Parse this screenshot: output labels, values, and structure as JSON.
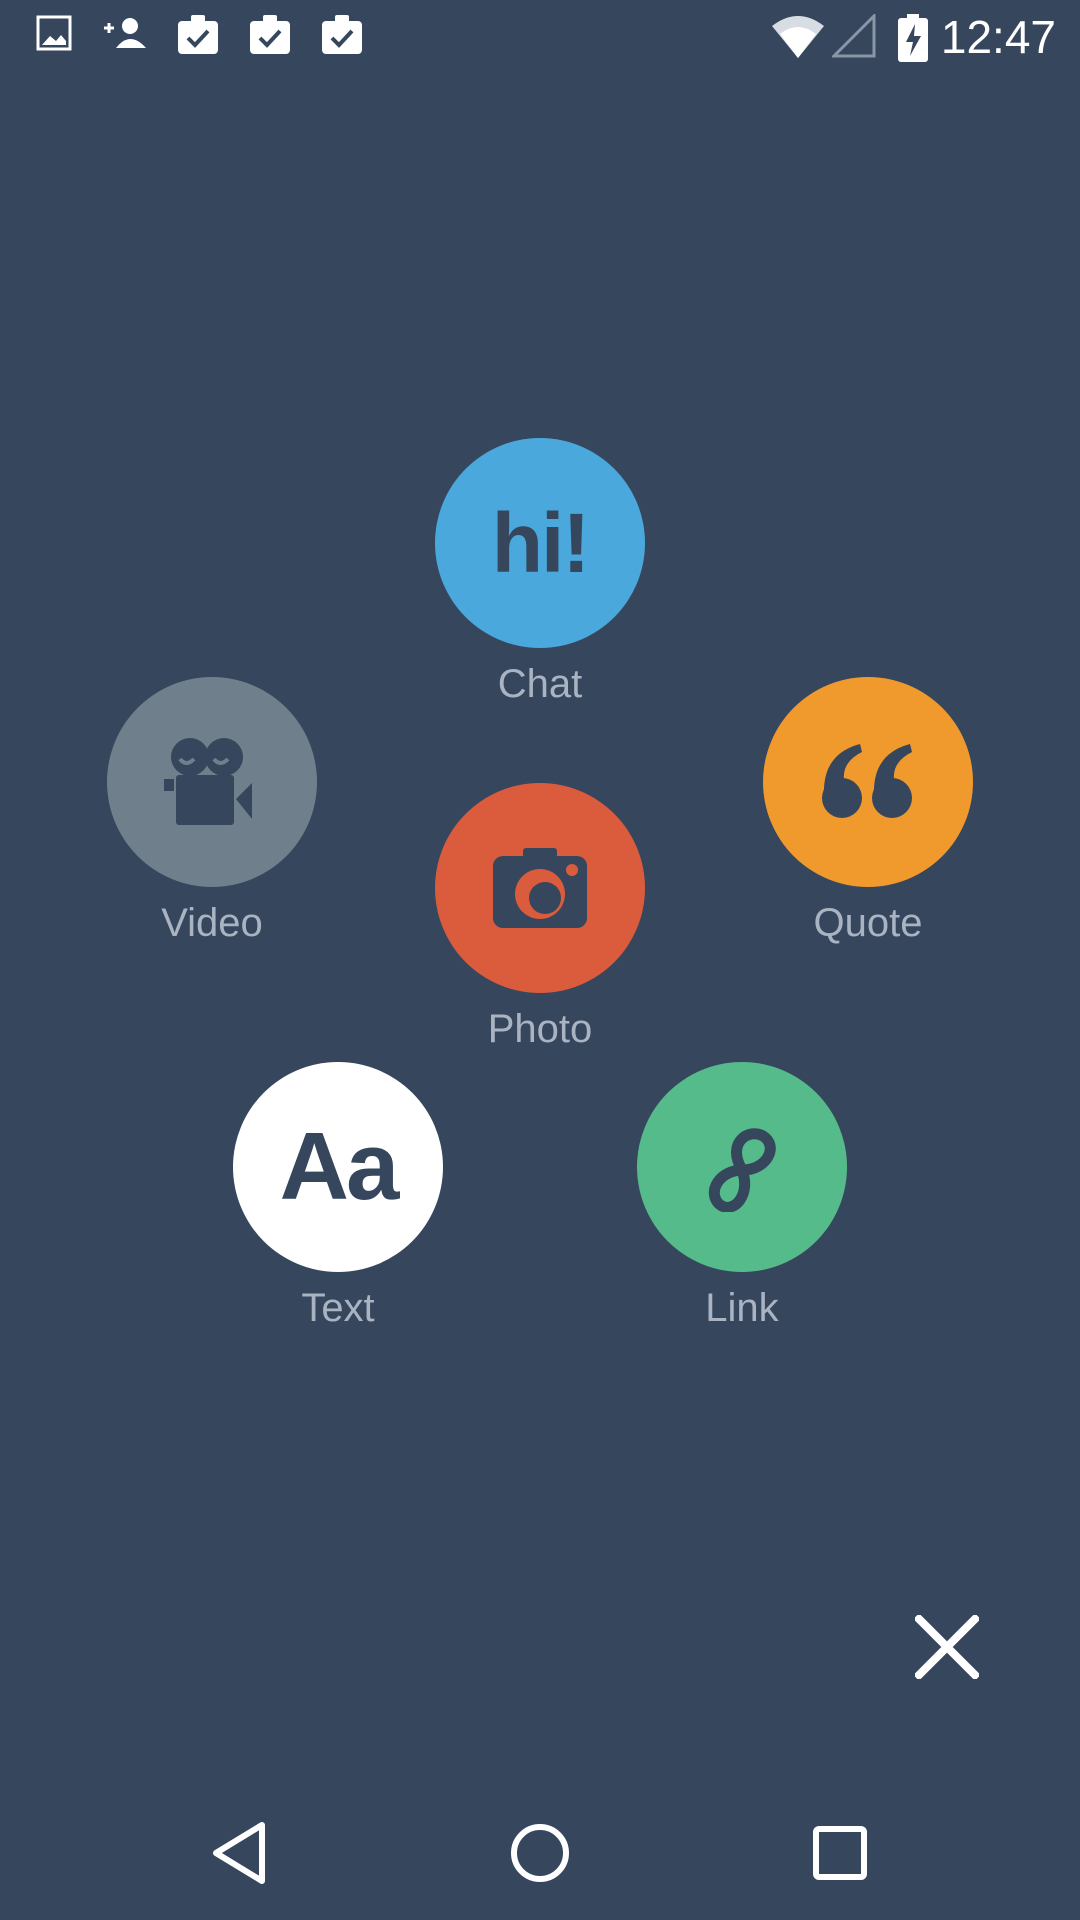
{
  "status_bar": {
    "time": "12:47",
    "icons": [
      "gallery-icon",
      "add-contact-icon",
      "clipboard-check-icon",
      "clipboard-check-icon",
      "clipboard-check-icon",
      "wifi-icon",
      "signal-icon",
      "battery-charging-icon"
    ]
  },
  "composer": {
    "options": [
      {
        "label": "Chat",
        "icon_text": "hi!",
        "icon": "chat-icon",
        "color": "#4aa8dc"
      },
      {
        "label": "Video",
        "icon": "video-camera-icon",
        "color": "#6f7f8c"
      },
      {
        "label": "Quote",
        "icon_text": "“",
        "icon": "quote-icon",
        "color": "#f09a2e"
      },
      {
        "label": "Photo",
        "icon": "camera-icon",
        "color": "#da5c3d"
      },
      {
        "label": "Text",
        "icon_text": "Aa",
        "icon": "text-icon",
        "color": "#ffffff"
      },
      {
        "label": "Link",
        "icon": "link-icon",
        "color": "#56bb8a"
      }
    ],
    "close_icon": "close-icon"
  },
  "nav_bar": {
    "buttons": [
      "back-icon",
      "home-icon",
      "recents-icon"
    ]
  },
  "colors": {
    "background": "#36465d",
    "label": "#a9b3c1",
    "icon_dark": "#36465d"
  }
}
